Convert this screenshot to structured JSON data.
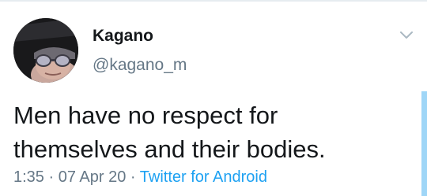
{
  "tweet": {
    "display_name": "Kagano",
    "handle": "@kagano_m",
    "text": "Men have no respect for\nthemselves and their bodies.",
    "time": "1:35",
    "separator1": " · ",
    "date": "07 Apr 20",
    "separator2": " · ",
    "source": "Twitter for Android"
  },
  "icons": {
    "avatar": "user-avatar-photo",
    "menu": "chevron-down-icon"
  },
  "colors": {
    "text_primary": "#14171a",
    "text_secondary": "#657786",
    "link": "#1da1f2",
    "accent_bar": "#9fd6f7"
  }
}
